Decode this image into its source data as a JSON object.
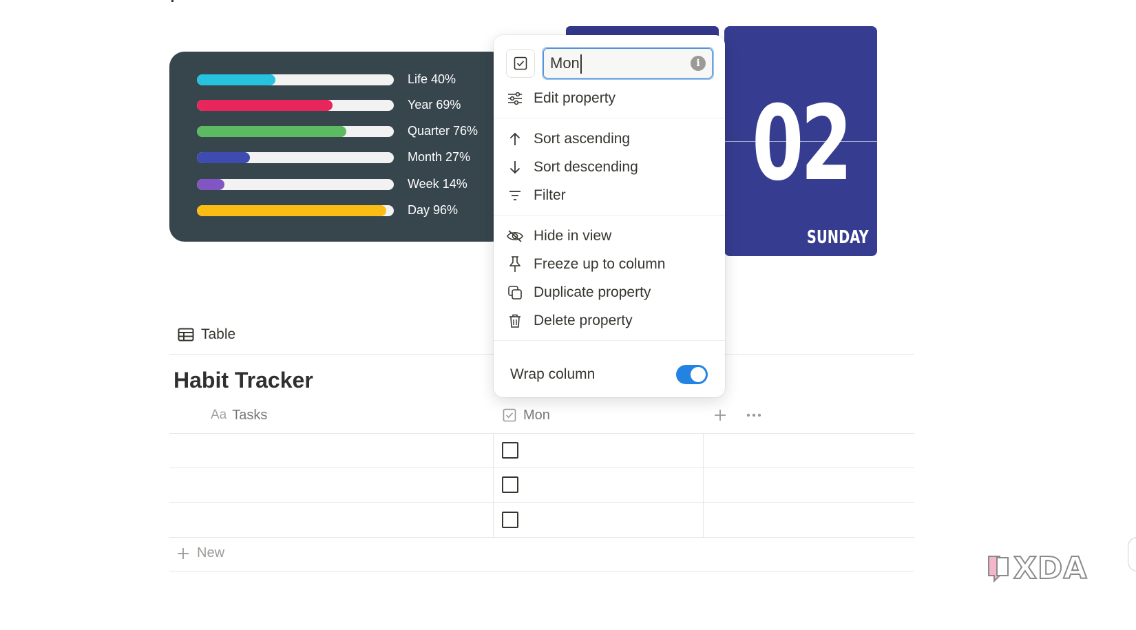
{
  "progress": [
    {
      "label": "Life 40%",
      "value": 0.4,
      "color": "#26c2de"
    },
    {
      "label": "Year 69%",
      "value": 0.69,
      "color": "#e8265b"
    },
    {
      "label": "Quarter 76%",
      "value": 0.76,
      "color": "#5cba62"
    },
    {
      "label": "Month 27%",
      "value": 0.27,
      "color": "#3e4bb0"
    },
    {
      "label": "Week 14%",
      "value": 0.14,
      "color": "#8255c5"
    },
    {
      "label": "Day 96%",
      "value": 0.96,
      "color": "#fbbd13"
    }
  ],
  "calendar": {
    "day_number": "02",
    "weekday": "SUNDAY"
  },
  "view": {
    "tab_label": "Table",
    "tab_icon": "table-icon"
  },
  "database": {
    "title": "Habit Tracker",
    "columns": [
      {
        "icon": "Aa",
        "label": "Tasks"
      },
      {
        "icon": "checkbox-icon",
        "label": "Mon"
      }
    ],
    "rows": [
      {
        "task": "",
        "mon": false
      },
      {
        "task": "",
        "mon": false
      },
      {
        "task": "",
        "mon": false
      }
    ],
    "new_label": "New",
    "add_column_icon": "plus-icon",
    "more_icon": "ellipsis-icon"
  },
  "menu": {
    "name_value": "Mon",
    "items": [
      {
        "label": "Edit property",
        "icon": "sliders-icon"
      },
      {
        "label": "Sort ascending",
        "icon": "arrow-up-icon"
      },
      {
        "label": "Sort descending",
        "icon": "arrow-down-icon"
      },
      {
        "label": "Filter",
        "icon": "filter-icon"
      },
      {
        "label": "Hide in view",
        "icon": "eye-slash-icon"
      },
      {
        "label": "Freeze up to column",
        "icon": "pin-icon"
      },
      {
        "label": "Duplicate property",
        "icon": "duplicate-icon"
      },
      {
        "label": "Delete property",
        "icon": "trash-icon"
      }
    ],
    "wrap_label": "Wrap column",
    "wrap_on": true,
    "accent": "#2383e2"
  },
  "watermark": {
    "text": "XDA"
  }
}
